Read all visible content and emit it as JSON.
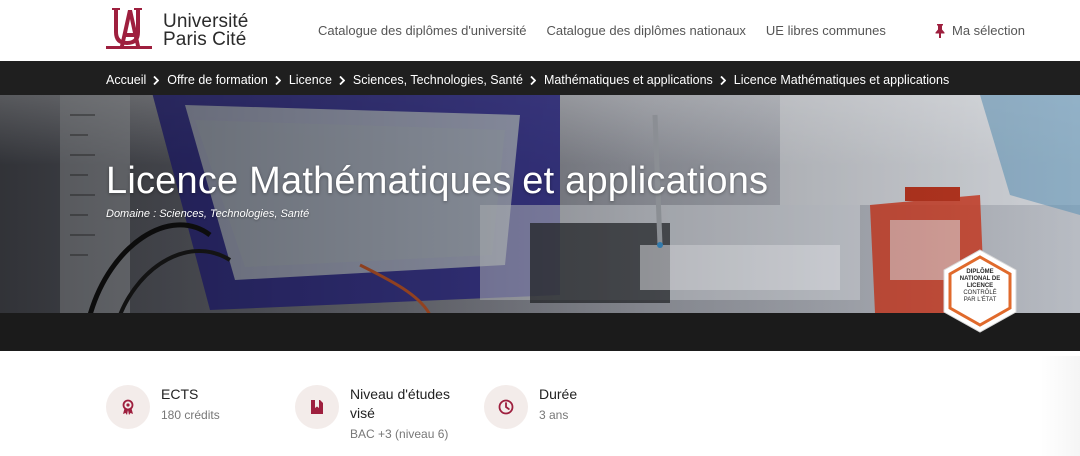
{
  "header": {
    "logo": {
      "line1": "Université",
      "line2": "Paris Cité"
    },
    "nav": [
      {
        "label": "Catalogue des diplômes d'université"
      },
      {
        "label": "Catalogue des diplômes nationaux"
      },
      {
        "label": "UE libres communes"
      }
    ],
    "selection_label": "Ma sélection"
  },
  "breadcrumb": [
    "Accueil",
    "Offre de formation",
    "Licence",
    "Sciences, Technologies, Santé",
    "Mathématiques et applications",
    "Licence Mathématiques et applications"
  ],
  "hero": {
    "title": "Licence Mathématiques et applications",
    "domain": "Domaine : Sciences, Technologies, Santé"
  },
  "badge": {
    "line1": "DIPLÔME",
    "line2": "NATIONAL DE",
    "line3": "LICENCE",
    "line4": "CONTRÔLÉ",
    "line5": "PAR L'ÉTAT"
  },
  "info": [
    {
      "icon": "award-icon",
      "label": "ECTS",
      "value": "180 crédits"
    },
    {
      "icon": "book-icon",
      "label": "Niveau d'études visé",
      "value": "BAC +3 (niveau 6)"
    },
    {
      "icon": "clock-icon",
      "label": "Durée",
      "value": "3 ans"
    }
  ],
  "colors": {
    "brand": "#9e1f3e",
    "dark_bar": "#1f1f1f",
    "icon_circle": "#f3ecea",
    "badge_orange": "#e06a2c"
  }
}
